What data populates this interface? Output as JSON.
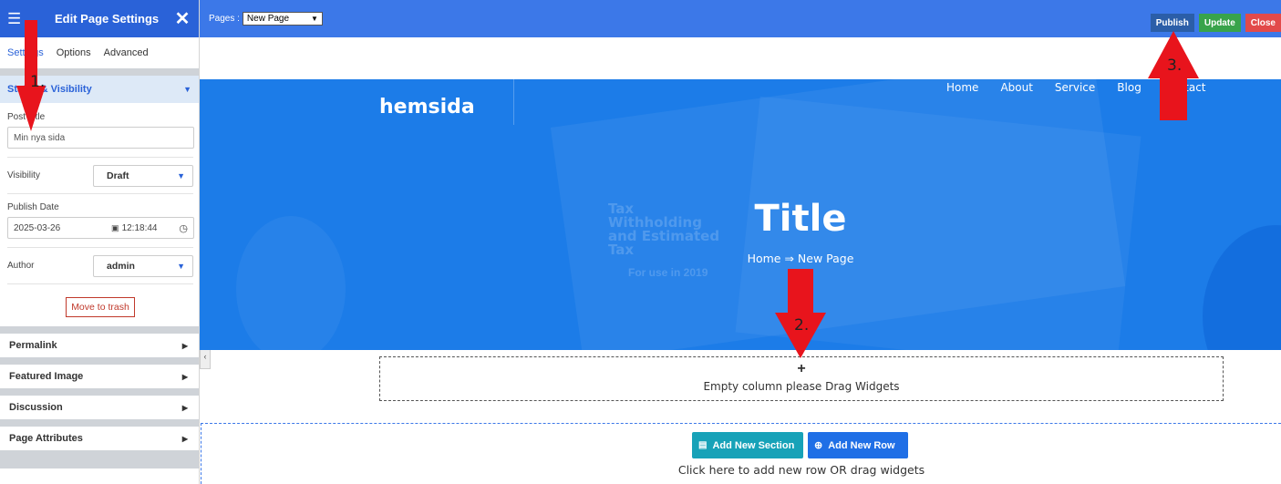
{
  "sidebar": {
    "title": "Edit Page Settings",
    "tabs": [
      "Settings",
      "Options",
      "Advanced"
    ],
    "open_section": "Status & Visibility",
    "post_title_label": "Post Title",
    "post_title_value": "Min nya sida",
    "visibility_label": "Visibility",
    "visibility_value": "Draft",
    "publish_date_label": "Publish Date",
    "publish_date": "2025-03-26",
    "publish_time": "12:18:44",
    "author_label": "Author",
    "author_value": "admin",
    "trash_label": "Move to trash",
    "sections": [
      "Permalink",
      "Featured Image",
      "Discussion",
      "Page Attributes"
    ]
  },
  "topbar": {
    "pages_label": "Pages :",
    "pages_value": "New Page",
    "publish": "Publish",
    "update": "Update",
    "close": "Close"
  },
  "hero": {
    "brand": "hemsida",
    "nav": [
      "Home",
      "About",
      "Service",
      "Blog",
      "Contact"
    ],
    "title": "Title",
    "breadcrumb": "Home ⇒ New Page",
    "bg_text": [
      "Tax",
      "Withholding",
      "and Estimated",
      "Tax"
    ],
    "bg_year": "For use in 2019"
  },
  "canvas": {
    "empty_plus": "+",
    "empty_text": "Empty column please Drag Widgets",
    "add_section": "Add New Section",
    "add_row": "Add New Row",
    "add_hint": "Click here to add new row OR drag widgets"
  },
  "annotations": [
    "1.",
    "2.",
    "3."
  ],
  "colors": {
    "header_blue": "#2a62d8",
    "topbar_blue": "#3c78e8",
    "hero_blue": "#1c7ce8",
    "publish": "#2b5ea8",
    "update": "#38a34a",
    "close": "#e24a4a",
    "arrow_red": "#e8141c"
  }
}
